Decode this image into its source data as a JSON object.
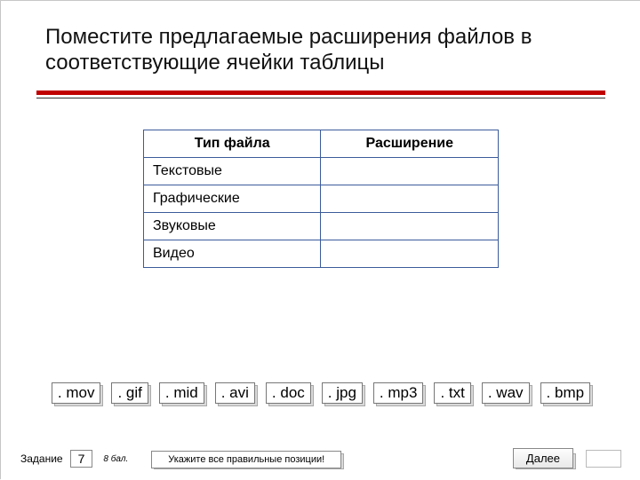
{
  "title": "Поместите предлагаемые расширения файлов в соответствующие ячейки таблицы",
  "table": {
    "headers": {
      "col1": "Тип файла",
      "col2": "Расширение"
    },
    "rows": [
      {
        "type": "Текстовые",
        "ext": ""
      },
      {
        "type": "Графические",
        "ext": ""
      },
      {
        "type": "Звуковые",
        "ext": ""
      },
      {
        "type": "Видео",
        "ext": ""
      }
    ]
  },
  "extensions": [
    ". mov",
    ". gif",
    ". mid",
    ". avi",
    ". doc",
    ". jpg",
    ". mp3",
    ". txt",
    ". wav",
    ". bmp"
  ],
  "footer": {
    "task_label": "Задание",
    "task_number": "7",
    "score": "8 бал.",
    "hint": "Укажите все правильные позиции!",
    "next": "Далее"
  }
}
